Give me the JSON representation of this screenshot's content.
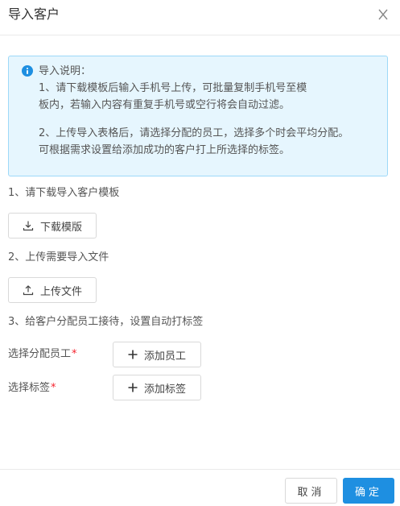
{
  "dialog": {
    "title": "导入客户",
    "close_icon": "close-icon"
  },
  "notice": {
    "icon": "info-icon",
    "heading": "导入说明：",
    "line1": "1、请下载模板后输入手机号上传，可批量复制手机号至模",
    "line2": "板内，若输入内容有重复手机号或空行将会自动过滤。",
    "line3": "2、上传导入表格后，请选择分配的员工，选择多个时会平均分配。",
    "line4": "可根据需求设置给添加成功的客户打上所选择的标签。"
  },
  "steps": {
    "step1": "1、请下载导入客户模板",
    "download_label": "下载模版",
    "step2": "2、上传需要导入文件",
    "upload_label": "上传文件",
    "step3": "3、给客户分配员工接待，设置自动打标签"
  },
  "form": {
    "staff_label": "选择分配员工",
    "add_staff_label": "添加员工",
    "tag_label": "选择标签",
    "add_tag_label": "添加标签",
    "required_mark": "*"
  },
  "footer": {
    "cancel_label": "取消",
    "ok_label": "确定"
  },
  "colors": {
    "primary": "#1e8fe1",
    "notice_bg": "#e6f6fe",
    "notice_border": "#9dd9f8",
    "required": "#f5222d"
  }
}
